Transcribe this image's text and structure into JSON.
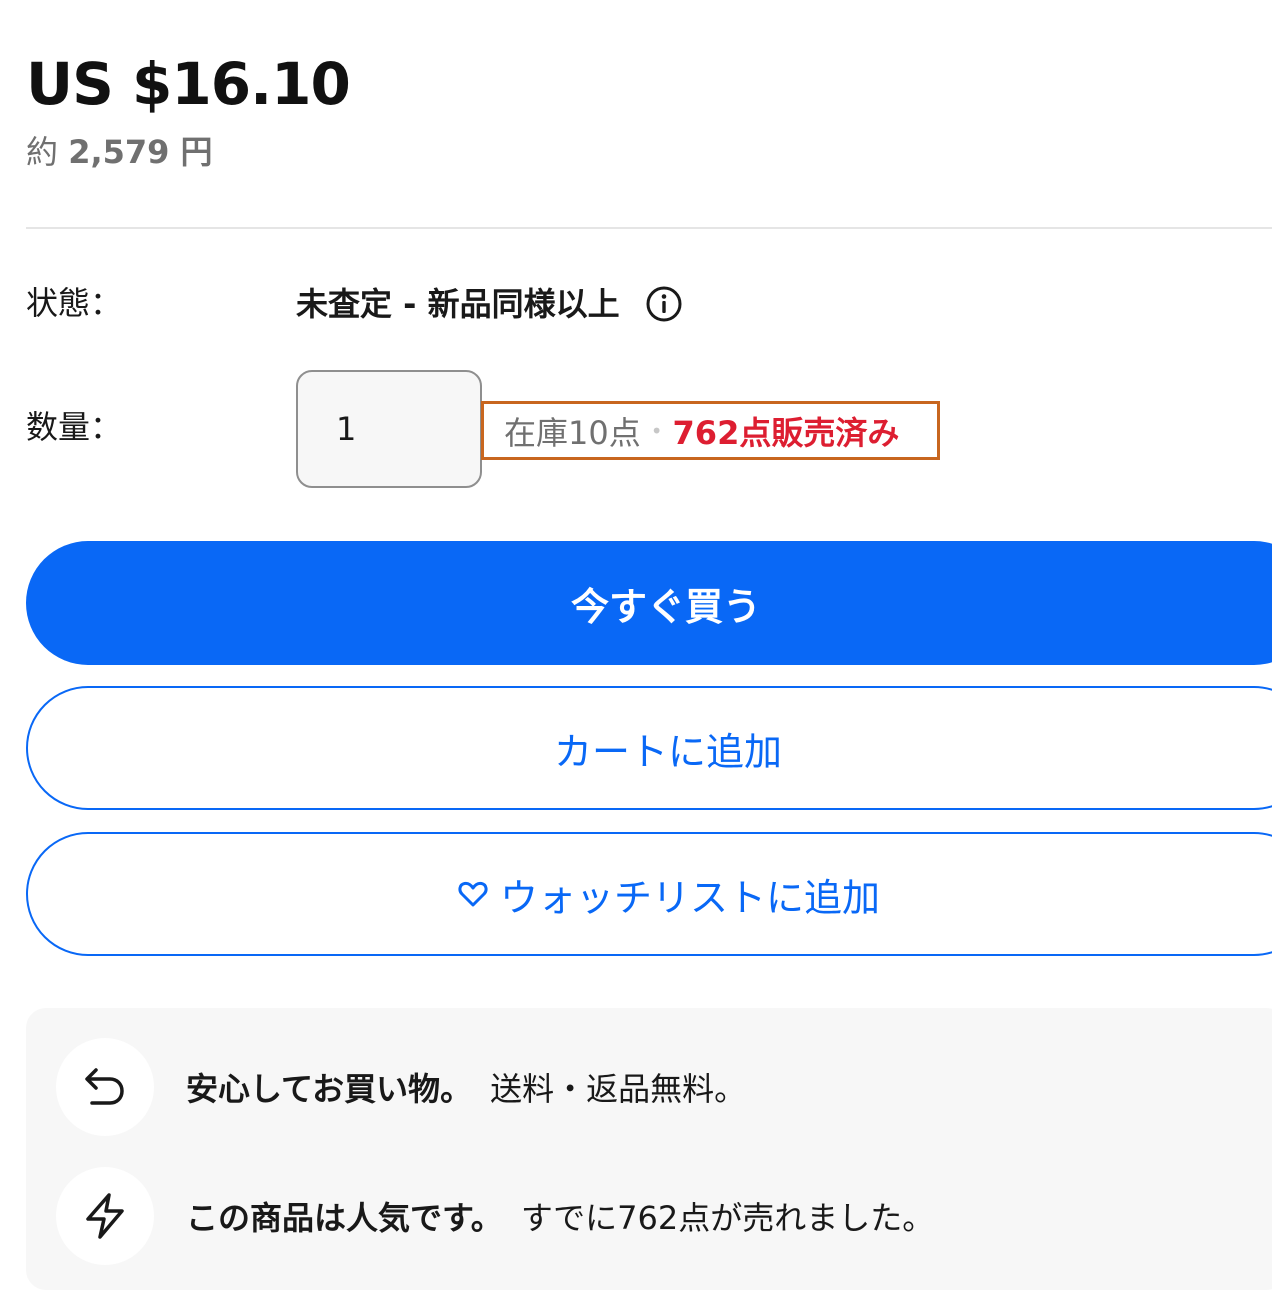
{
  "price": {
    "main": "US $16.10",
    "approx_prefix": "約",
    "approx_amount": "2,579 円"
  },
  "condition": {
    "label": "状態：",
    "value": "未査定 - 新品同様以上"
  },
  "quantity": {
    "label": "数量：",
    "value": "1",
    "available": "在庫10点",
    "separator": "•",
    "sold": "762点販売済み"
  },
  "buttons": {
    "buy_now": "今すぐ買う",
    "add_to_cart": "カートに追加",
    "add_to_watchlist": "ウォッチリストに追加"
  },
  "info_panel": {
    "items": [
      {
        "icon": "return-arrow-icon",
        "title": "安心してお買い物。",
        "desc": "送料・返品無料。"
      },
      {
        "icon": "lightning-icon",
        "title": "この商品は人気です。",
        "desc": "すでに762点が売れました。"
      }
    ]
  },
  "colors": {
    "primary": "#0968f6",
    "sold_red": "#dd1e31",
    "highlight_box": "#c8661f",
    "panel_bg": "#f7f7f7"
  }
}
